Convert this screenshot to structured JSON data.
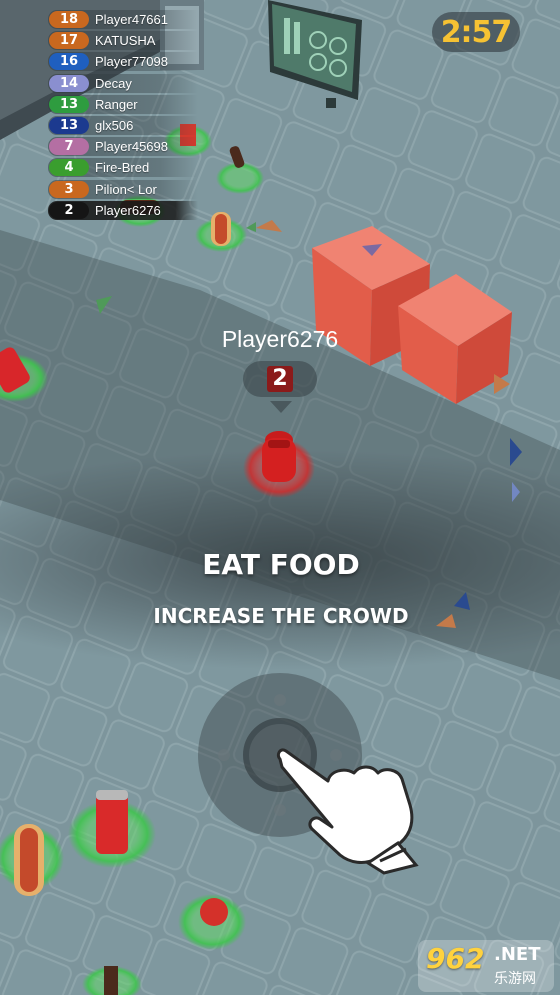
{
  "leaderboard": [
    {
      "rank": "18",
      "name": "Player47661",
      "color": "#c9681f"
    },
    {
      "rank": "17",
      "name": "KATUSHA",
      "color": "#c9681f"
    },
    {
      "rank": "16",
      "name": "Player77098",
      "color": "#1f5fbf"
    },
    {
      "rank": "14",
      "name": "Decay",
      "color": "#8a8fd0"
    },
    {
      "rank": "13",
      "name": "Ranger",
      "color": "#2e9c3f"
    },
    {
      "rank": "13",
      "name": "glx506",
      "color": "#1c3a8f"
    },
    {
      "rank": "7",
      "name": "Player45698",
      "color": "#b46fa3"
    },
    {
      "rank": "4",
      "name": "Fire-Bred",
      "color": "#3a9e2e"
    },
    {
      "rank": "3",
      "name": "Pilion< Lor",
      "color": "#c9681f"
    },
    {
      "rank": "2",
      "name": "Player6276",
      "color": "#151515"
    }
  ],
  "timer": "2:57",
  "player": {
    "name": "Player6276",
    "count": "2",
    "color": "#c62020"
  },
  "tutorial": {
    "title": "EAT FOOD",
    "subtitle": "INCREASE THE CROWD"
  },
  "watermark": {
    "number": "962",
    "domain": ".NET",
    "site": "乐游网"
  },
  "joystick": {
    "icon": "hand-pointer-icon"
  }
}
